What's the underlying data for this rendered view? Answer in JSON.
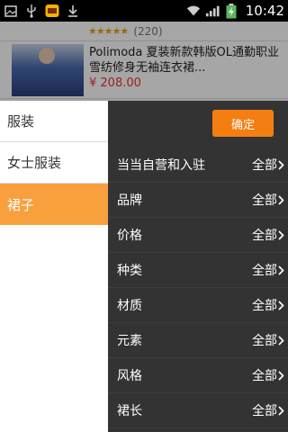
{
  "status_bar": {
    "time": "10:42",
    "icons": [
      "photo-icon",
      "usb-icon",
      "app-notification-icon",
      "download-icon",
      "wifi-icon",
      "signal-icon",
      "battery-charging-icon"
    ]
  },
  "background_list": {
    "rating_stars": "★★★★★",
    "review_count": "(220)",
    "product_title": "Polimoda 夏装新款韩版OL通勤职业雪纺修身无袖连衣裙...",
    "product_price": "¥ 208.00"
  },
  "categories": [
    {
      "label": "服装",
      "active": false
    },
    {
      "label": "女士服装",
      "active": false
    },
    {
      "label": "裙子",
      "active": true
    }
  ],
  "filter_panel": {
    "confirm_label": "确定",
    "filters": [
      {
        "label": "当当自营和入驻",
        "value": "全部"
      },
      {
        "label": "品牌",
        "value": "全部"
      },
      {
        "label": "价格",
        "value": "全部"
      },
      {
        "label": "种类",
        "value": "全部"
      },
      {
        "label": "材质",
        "value": "全部"
      },
      {
        "label": "元素",
        "value": "全部"
      },
      {
        "label": "风格",
        "value": "全部"
      },
      {
        "label": "裙长",
        "value": "全部"
      }
    ]
  },
  "colors": {
    "accent_orange": "#f57e12",
    "active_category": "#f8a03d",
    "filter_bg": "#333333",
    "price_red": "#ee3333"
  }
}
